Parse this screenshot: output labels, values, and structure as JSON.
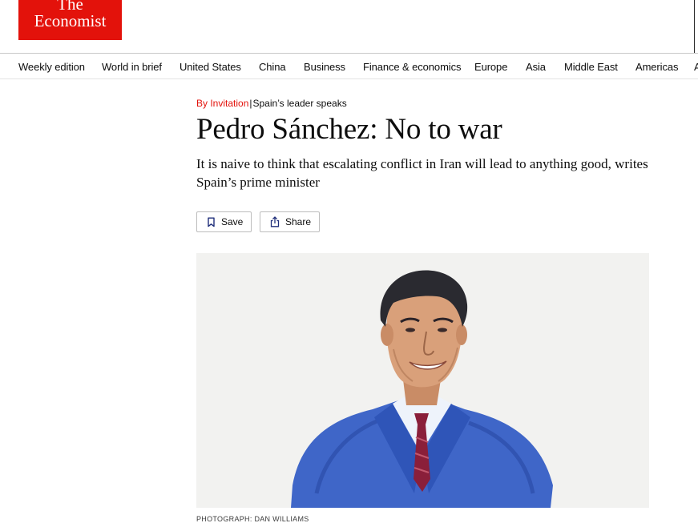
{
  "brand": {
    "logo_line1": "The",
    "logo_line2": "Economist",
    "color": "#e3120b"
  },
  "nav": {
    "items": [
      {
        "label": "Weekly edition"
      },
      {
        "label": "World in brief"
      },
      {
        "label": "United States"
      },
      {
        "label": "China"
      },
      {
        "label": "Business"
      },
      {
        "label": "Finance & economics"
      },
      {
        "label": "Europe"
      },
      {
        "label": "Asia"
      },
      {
        "label": "Middle East"
      },
      {
        "label": "Americas"
      }
    ],
    "overflow_glyph": "A"
  },
  "article": {
    "section_label": "By Invitation",
    "separator": "|",
    "subsection": "Spain’s leader speaks",
    "headline": "Pedro Sánchez: No to war",
    "rubric": "It is naive to think that escalating conflict in Iran will lead to anything good, writes Spain’s prime minister",
    "actions": {
      "save_label": "Save",
      "share_label": "Share"
    },
    "image": {
      "caption": "PHOTOGRAPH: DAN WILLIAMS"
    }
  },
  "icons": [
    "bookmark-icon",
    "share-icon"
  ]
}
